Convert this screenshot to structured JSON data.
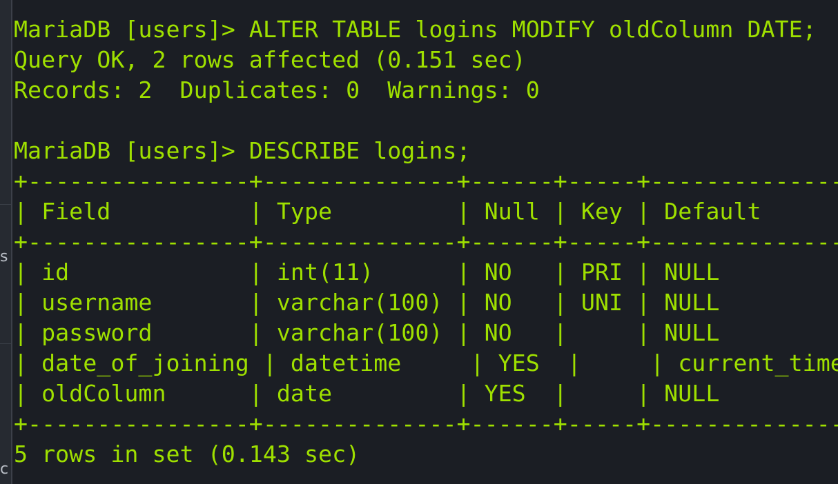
{
  "sidebar": {
    "fragment_1": "s",
    "fragment_2": "c"
  },
  "terminal": {
    "lines": [
      "MariaDB [users]> ALTER TABLE logins MODIFY oldColumn DATE;",
      "Query OK, 2 rows affected (0.151 sec)",
      "Records: 2  Duplicates: 0  Warnings: 0",
      "",
      "MariaDB [users]> DESCRIBE logins;",
      "+----------------+--------------+------+-----+-------------------",
      "| Field          | Type         | Null | Key | Default",
      "+----------------+--------------+------+-----+-------------------",
      "| id             | int(11)      | NO   | PRI | NULL",
      "| username       | varchar(100) | NO   | UNI | NULL",
      "| password       | varchar(100) | NO   |     | NULL",
      "| date_of_joining | datetime     | YES  |     | current_timestamp()",
      "| oldColumn      | date         | YES  |     | NULL",
      "+----------------+--------------+------+-----+-------------------",
      "5 rows in set (0.143 sec)"
    ]
  }
}
